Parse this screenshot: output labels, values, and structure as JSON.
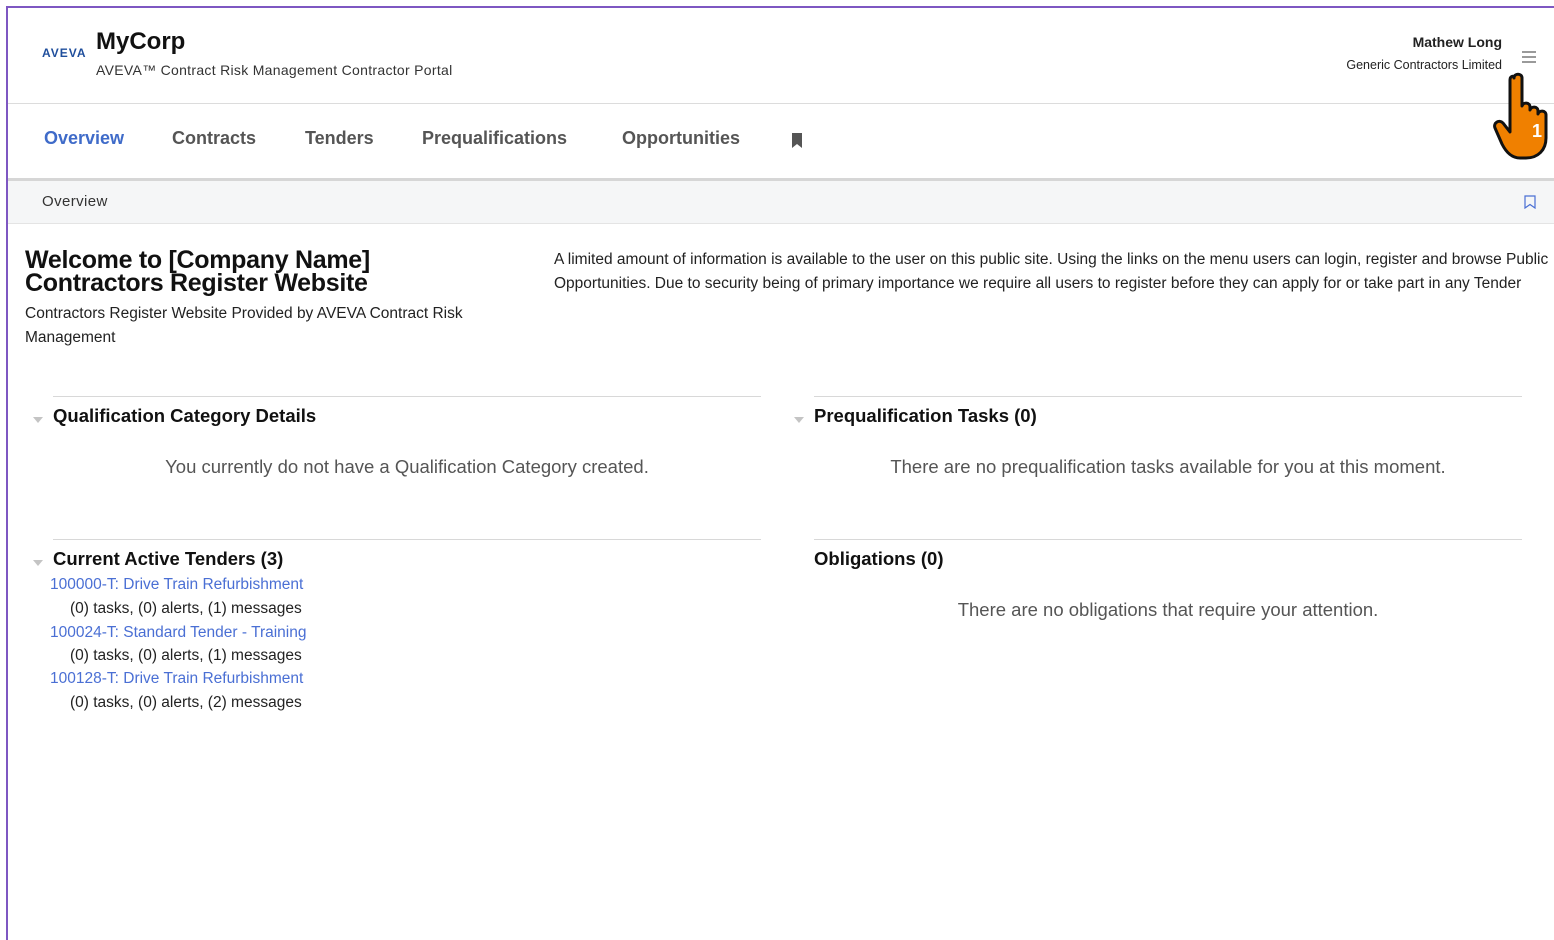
{
  "header": {
    "logo_text": "AVEVA",
    "brand_name": "MyCorp",
    "brand_subtitle": "AVEVA™ Contract Risk Management Contractor Portal",
    "user_name": "Mathew Long",
    "user_company": "Generic Contractors Limited",
    "step_badge": "1"
  },
  "nav": {
    "items": [
      {
        "label": "Overview"
      },
      {
        "label": "Contracts"
      },
      {
        "label": "Tenders"
      },
      {
        "label": "Prequalifications"
      },
      {
        "label": "Opportunities"
      }
    ],
    "active": "Overview"
  },
  "breadcrumb": {
    "label": "Overview"
  },
  "welcome": {
    "title_line1": "Welcome to [Company Name]",
    "title_line2": "Contractors Register Website",
    "subtitle": "Contractors Register Website Provided by AVEVA Contract Risk Management",
    "info": "A limited amount of information is available to the user on this public site. Using the links on the menu users can login, register and browse Public Opportunities. Due to security being of primary importance we require all users to register before they can apply for or take part in any Tender"
  },
  "panels": {
    "qualification": {
      "title": "Qualification Category Details",
      "message": "You currently do not have a Qualification Category created."
    },
    "prequal_tasks": {
      "title": "Prequalification Tasks (0)",
      "message": "There are no prequalification tasks available for you at this moment."
    },
    "tenders": {
      "title": "Current Active Tenders (3)",
      "items": [
        {
          "link": "100000-T: Drive Train Refurbishment",
          "meta": "(0) tasks, (0) alerts, (1) messages"
        },
        {
          "link": "100024-T: Standard Tender - Training",
          "meta": "(0) tasks, (0) alerts, (1) messages"
        },
        {
          "link": "100128-T: Drive Train Refurbishment",
          "meta": "(0) tasks, (0) alerts, (2) messages"
        }
      ]
    },
    "obligations": {
      "title": "Obligations (0)",
      "message": "There are no obligations that require your attention."
    }
  },
  "colors": {
    "accent_link": "#4a6fd4",
    "active_tab": "#3f6bc9",
    "frame_border": "#7e57c2",
    "pointer_orange": "#f08000"
  }
}
